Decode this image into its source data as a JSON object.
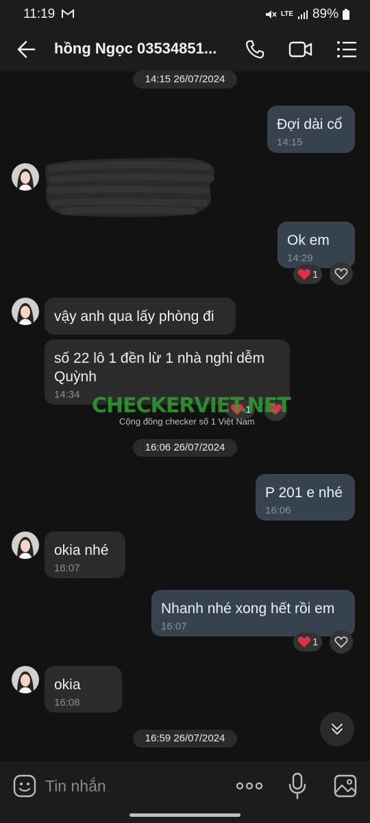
{
  "status": {
    "time": "11:19",
    "battery": "89%",
    "network": "LTE"
  },
  "header": {
    "title": "hồng Ngọc 03534851...",
    "icons": [
      "back-arrow-icon",
      "phone-icon",
      "video-icon",
      "menu-icon"
    ]
  },
  "dates": {
    "d1": "14:15 26/07/2024",
    "d2": "16:06 26/07/2024",
    "d3": "16:59 26/07/2024"
  },
  "messages": [
    {
      "dir": "out",
      "text": "Đợi dài cổ",
      "time": "14:15"
    },
    {
      "dir": "in",
      "text": "",
      "time": "",
      "redacted": true
    },
    {
      "dir": "out",
      "text": "Ok em",
      "time": "14:29",
      "reaction_count": "1"
    },
    {
      "dir": "in",
      "text": "vậy anh qua lấy phòng đi",
      "time": ""
    },
    {
      "dir": "in",
      "text": "số 22 lô 1 đền lừ 1 nhà nghỉ dễm Quỳnh",
      "time": "14:34",
      "reaction_count": "1"
    },
    {
      "dir": "out",
      "text": "P 201 e nhé",
      "time": "16:06"
    },
    {
      "dir": "in",
      "text": "okia nhé",
      "time": "16:07"
    },
    {
      "dir": "out",
      "text": "Nhanh nhé xong hết rồi em",
      "time": "16:07",
      "reaction_count": "1"
    },
    {
      "dir": "in",
      "text": "okia",
      "time": "16:08"
    }
  ],
  "watermark": {
    "text": "CHECKERVIET.NET",
    "sub": "Cộng đồng checker số 1 Việt Nam"
  },
  "composer": {
    "placeholder": "Tin nhắn"
  },
  "colors": {
    "outgoing_bubble": "#36434f",
    "incoming_bubble": "#2b2b2b",
    "background": "#121212",
    "heart": "#e0304a"
  }
}
